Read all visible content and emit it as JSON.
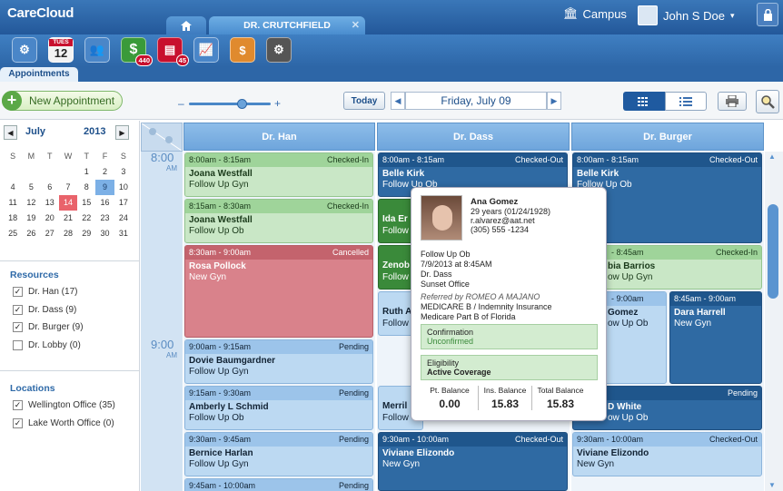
{
  "header": {
    "logo": "CareCloud",
    "patient_tab": "DR. CRUTCHFIELD",
    "campus": "Campus",
    "user": "John S Doe"
  },
  "apps": {
    "calendar_day": "TUES",
    "calendar_date": "12",
    "billing_badge": "440",
    "docs_badge": "45"
  },
  "tabs": {
    "appointments": "Appointments"
  },
  "toolbar": {
    "new_appointment": "New Appointment",
    "zoom_minus": "–",
    "zoom_plus": "+",
    "today": "Today",
    "current_date": "Friday, July 09"
  },
  "calendar": {
    "month": "July",
    "year": "2013",
    "dow": [
      "S",
      "M",
      "T",
      "W",
      "T",
      "F",
      "S"
    ],
    "weeks": [
      [
        "",
        "",
        "",
        "",
        "",
        "",
        ""
      ],
      [
        "",
        "",
        "",
        "",
        "1",
        "2",
        "3"
      ],
      [
        "4",
        "5",
        "6",
        "7",
        "8",
        "9",
        "10"
      ],
      [
        "11",
        "12",
        "13",
        "14",
        "15",
        "16",
        "17"
      ],
      [
        "18",
        "19",
        "20",
        "21",
        "22",
        "23",
        "24"
      ],
      [
        "25",
        "26",
        "27",
        "28",
        "29",
        "30",
        "31"
      ]
    ],
    "today": "14",
    "selected": "9"
  },
  "resources": {
    "title": "Resources",
    "items": [
      {
        "label": "Dr. Han (17)",
        "checked": true
      },
      {
        "label": "Dr. Dass (9)",
        "checked": true
      },
      {
        "label": "Dr. Burger (9)",
        "checked": true
      },
      {
        "label": "Dr. Lobby (0)",
        "checked": false
      }
    ]
  },
  "locations": {
    "title": "Locations",
    "items": [
      {
        "label": "Wellington Office (35)",
        "checked": true
      },
      {
        "label": "Lake Worth Office (0)",
        "checked": true
      }
    ]
  },
  "schedule": {
    "time_8": "8:00",
    "ampm_8": "AM",
    "time_9": "9:00",
    "ampm_9": "AM",
    "columns": [
      "Dr. Han",
      "Dr. Dass",
      "Dr. Burger"
    ]
  },
  "appointments": {
    "han": [
      {
        "time": "8:00am - 8:15am",
        "status": "Checked-In",
        "name": "Joana Westfall",
        "type": "Follow Up Gyn"
      },
      {
        "time": "8:15am - 8:30am",
        "status": "Checked-In",
        "name": "Joana Westfall",
        "type": "Follow Up Ob"
      },
      {
        "time": "8:30am - 9:00am",
        "status": "Cancelled",
        "name": "Rosa Pollock",
        "type": "New Gyn"
      },
      {
        "time": "9:00am - 9:15am",
        "status": "Pending",
        "name": "Dovie Baumgardner",
        "type": "Follow Up Gyn"
      },
      {
        "time": "9:15am - 9:30am",
        "status": "Pending",
        "name": "Amberly L Schmid",
        "type": "Follow Up Ob"
      },
      {
        "time": "9:30am - 9:45am",
        "status": "Pending",
        "name": "Bernice Harlan",
        "type": "Follow Up Gyn"
      },
      {
        "time": "9:45am - 10:00am",
        "status": "Pending"
      }
    ],
    "dass": [
      {
        "time": "8:00am - 8:15am",
        "status": "Checked-Out",
        "name": "Belle Kirk",
        "type": "Follow Up Ob"
      },
      {
        "name": "Ida Er",
        "type": "Follow"
      },
      {
        "name": "Zenob",
        "type": "Follow"
      },
      {
        "name": "Ruth A",
        "type": "Follow"
      },
      {
        "name": "Merril",
        "type": "Follow"
      },
      {
        "time": "9:30am - 10:00am",
        "status": "Checked-Out",
        "name": "Viviane Elizondo",
        "type": "New Gyn"
      }
    ],
    "burger": [
      {
        "time": "8:00am - 8:15am",
        "status": "Checked-Out",
        "name": "Belle Kirk",
        "type": "Follow Up Ob"
      },
      {
        "time": "- 8:45am",
        "status": "Checked-In",
        "name": "bia Barrios",
        "type": "ow Up Gyn"
      },
      {
        "time": "- 9:00am",
        "name": "Gomez",
        "type": "ow Up Ob"
      },
      {
        "time": "8:45am - 9:00am",
        "name": "Dara Harrell",
        "type": "New Gyn"
      },
      {
        "status": "Pending",
        "name": "D White",
        "type": "ow Up Ob"
      },
      {
        "time": "9:30am - 10:00am",
        "status": "Checked-Out",
        "name": "Viviane Elizondo",
        "type": "New Gyn"
      }
    ]
  },
  "popup": {
    "name": "Ana Gomez",
    "age": "29 years (01/24/1928)",
    "email": "r.alvarez@aat.net",
    "phone": "(305) 555 -1234",
    "visit_type": "Follow Up Ob",
    "datetime": "7/9/2013 at 8:45AM",
    "provider": "Dr. Dass",
    "office": "Sunset Office",
    "referred": "Referred by ROMEO A MAJANO",
    "insurance1": "MEDICARE B / Indemnity Insurance",
    "insurance2": "Medicare Part B of Florida",
    "confirmation_label": "Confirmation",
    "confirmation_value": "Unconfirmed",
    "eligibility_label": "Eligibility",
    "eligibility_value": "Active Coverage",
    "pt_balance_label": "Pt. Balance",
    "pt_balance": "0.00",
    "ins_balance_label": "Ins. Balance",
    "ins_balance": "15.83",
    "total_balance_label": "Total Balance",
    "total_balance": "15.83"
  },
  "colors": {
    "header_blue": "#2d66a7",
    "checked_in_green": "#c9e7c6",
    "cancelled_red": "#d9828b",
    "checked_out_blue": "#2f6aa3",
    "pending_blue": "#bcd9f2"
  }
}
